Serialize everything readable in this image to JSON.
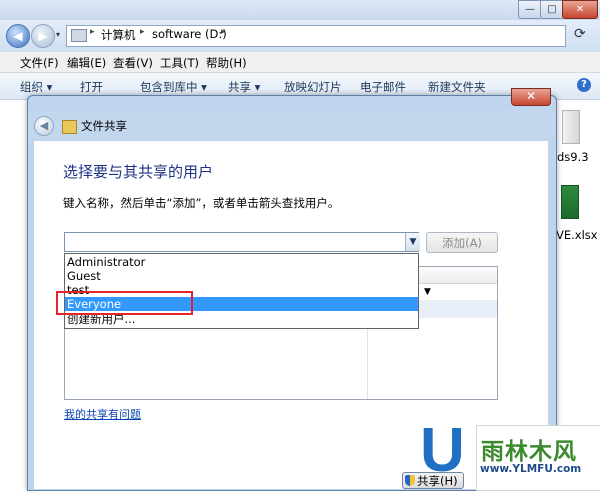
{
  "explorer": {
    "window_buttons": [
      "—",
      "□",
      "✕"
    ],
    "address": {
      "segments": [
        "计算机",
        "software (D:)"
      ],
      "separator": "▸"
    },
    "menu": [
      "文件(F)",
      "编辑(E)",
      "查看(V)",
      "工具(T)",
      "帮助(H)"
    ],
    "toolbar": [
      "组织 ▾",
      "打开",
      "包含到库中 ▾",
      "共享 ▾",
      "放映幻灯片",
      "电子邮件",
      "新建文件夹"
    ],
    "files": [
      "ds9.3",
      "VE.xlsx"
    ]
  },
  "dialog": {
    "title": "文件共享",
    "heading": "选择要与其共享的用户",
    "instruction": "键入名称，然后单击“添加”，或者单击箭头查找用户。",
    "combo_value": "",
    "add_button": "添加(A)",
    "dropdown_items": [
      "Administrator",
      "Guest",
      "test",
      "Everyone",
      "创建新用户..."
    ],
    "selected_item": "Everyone",
    "help_link": "我的共享有问题",
    "share_button": "共享(H)"
  },
  "watermark": {
    "letter": "U",
    "text": "雨林木风",
    "url": "www.YLMFU.com"
  },
  "colors": {
    "heading": "#1e3287",
    "highlight": "#3399ff",
    "annotation_box": "#e0262b",
    "link": "#0a43b2"
  }
}
